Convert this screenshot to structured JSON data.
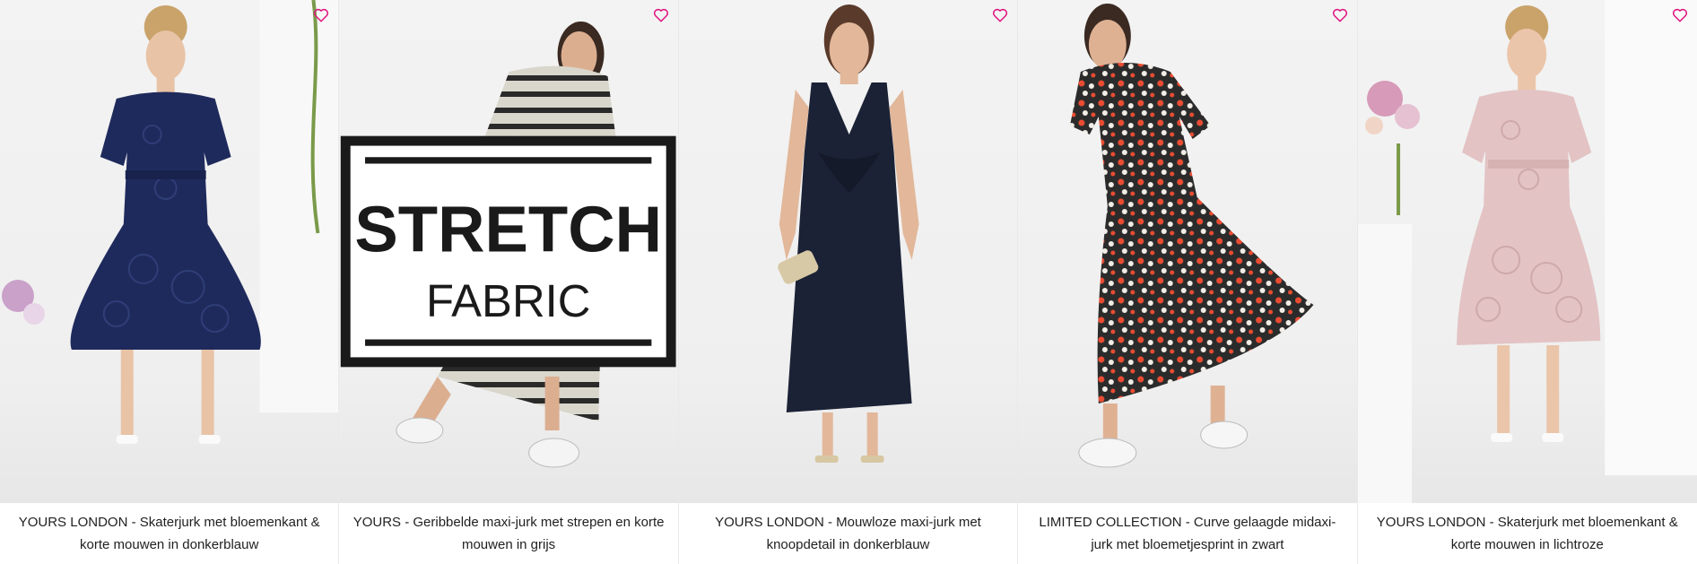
{
  "accent_color": "#e0117f",
  "products": [
    {
      "title": "YOURS LONDON - Skaterjurk met bloemenkant & korte mouwen in donkerblauw",
      "dress_color": "#1f2a5c",
      "pattern": "lace",
      "wishlist_icon": "heart-outline-icon"
    },
    {
      "title": "YOURS - Geribbelde maxi-jurk met strepen en korte mouwen in grijs",
      "dress_color": "#d9d6cc",
      "pattern": "stripes",
      "wishlist_icon": "heart-outline-icon",
      "badge": {
        "line1": "STRETCH",
        "line2": "FABRIC"
      }
    },
    {
      "title": "YOURS LONDON - Mouwloze maxi-jurk met knoopdetail in donkerblauw",
      "dress_color": "#1b2236",
      "pattern": "solid",
      "wishlist_icon": "heart-outline-icon"
    },
    {
      "title": "LIMITED COLLECTION - Curve gelaagde midaxi-jurk met bloemetjesprint in zwart",
      "dress_color": "#2b2b2b",
      "pattern": "floral",
      "wishlist_icon": "heart-outline-icon"
    },
    {
      "title": "YOURS LONDON - Skaterjurk met bloemenkant & korte mouwen in lichtroze",
      "dress_color": "#e3c3c4",
      "pattern": "lace",
      "wishlist_icon": "heart-outline-icon"
    }
  ]
}
